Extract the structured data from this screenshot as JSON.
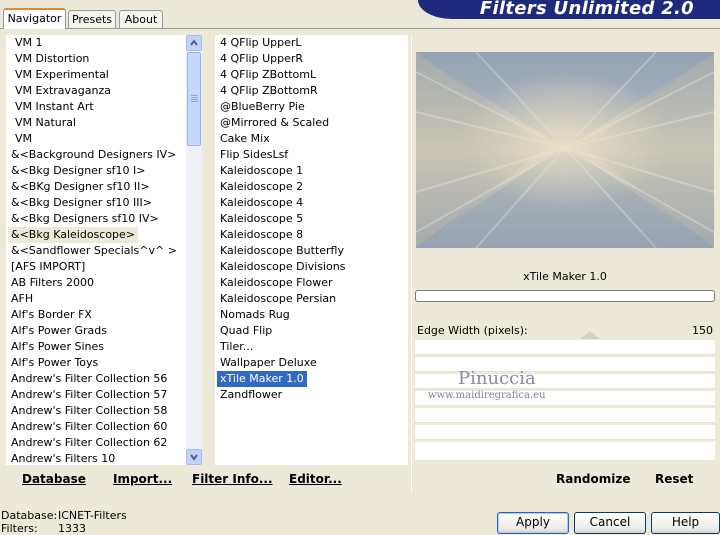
{
  "tabs": [
    {
      "label": "Navigator",
      "active": true
    },
    {
      "label": "Presets",
      "active": false
    },
    {
      "label": "About",
      "active": false
    }
  ],
  "app_title": "Filters Unlimited 2.0",
  "categories": {
    "items": [
      "VM 1",
      "VM Distortion",
      "VM Experimental",
      "VM Extravaganza",
      "VM Instant Art",
      "VM Natural",
      "VM",
      "&<Background Designers IV>",
      "&<Bkg Designer sf10 I>",
      "&<BKg Designer sf10 II>",
      "&<Bkg Designer sf10 III>",
      "&<Bkg Designers sf10 IV>",
      "&<Bkg Kaleidoscope>",
      "&<Sandflower Specials^v^ >",
      "[AFS IMPORT]",
      "AB Filters 2000",
      "AFH",
      "Alf's Border FX",
      "Alf's Power Grads",
      "Alf's Power Sines",
      "Alf's Power Toys",
      "Andrew's Filter Collection 56",
      "Andrew's Filter Collection 57",
      "Andrew's Filter Collection 58",
      "Andrew's Filter Collection 60",
      "Andrew's Filter Collection 62",
      "Andrew's Filters 10"
    ],
    "highlighted": "&<Bkg Kaleidoscope>"
  },
  "filters": {
    "items": [
      "4 QFlip UpperL",
      "4 QFlip UpperR",
      "4 QFlip ZBottomL",
      "4 QFlip ZBottomR",
      "@BlueBerry Pie",
      "@Mirrored & Scaled",
      "Cake Mix",
      "Flip SidesLsf",
      "Kaleidoscope 1",
      "Kaleidoscope 2",
      "Kaleidoscope 4",
      "Kaleidoscope 5",
      "Kaleidoscope 8",
      "Kaleidoscope Butterfly",
      "Kaleidoscope Divisions",
      "Kaleidoscope Flower",
      "Kaleidoscope Persian",
      "Nomads Rug",
      "Quad Flip",
      "Tiler...",
      "Wallpaper Deluxe",
      "xTile Maker 1.0",
      "Zandflower"
    ],
    "selected": "xTile Maker 1.0"
  },
  "list_toolbar": {
    "database": "Database",
    "import": "Import...",
    "filter_info": "Filter Info...",
    "editor": "Editor..."
  },
  "preview": {
    "filter_name": "xTile Maker 1.0"
  },
  "params": {
    "label": "Edge Width (pixels):",
    "value": "150"
  },
  "watermark": {
    "line1": "Pinuccia",
    "line2": "www.maidiregrafica.eu"
  },
  "param_buttons": {
    "randomize": "Randomize",
    "reset": "Reset"
  },
  "status": {
    "database_label": "Database:",
    "database_value": "ICNET-Filters",
    "filters_label": "Filters:",
    "filters_value": "1333"
  },
  "dialog_buttons": {
    "apply": "Apply",
    "cancel": "Cancel",
    "help": "Help"
  },
  "colors": {
    "selection": "#316ac5",
    "title_band": "#1d2a7d",
    "face": "#ece9d8"
  }
}
